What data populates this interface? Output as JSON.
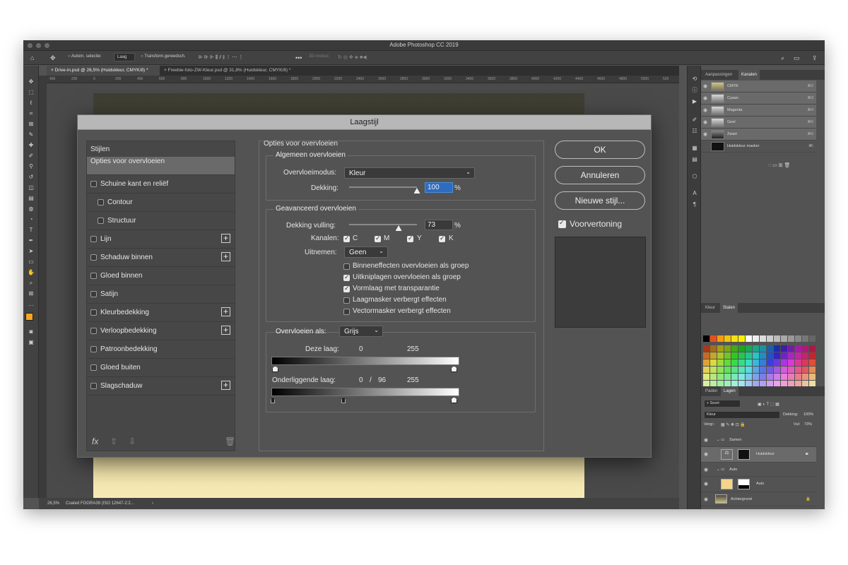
{
  "window": {
    "title": "Adobe Photoshop CC 2019"
  },
  "optionsbar": {
    "auto_select_label": "Autom. selectie:",
    "auto_select_value": "Laag",
    "transform_label": "Transform.gereedsch.",
    "mode_3d": "3D-modus:"
  },
  "doc_tabs": [
    {
      "label": "Drive-in.psd @ 26,5% (Huidskleur, CMYK/8) *"
    },
    {
      "label": "Freebie-foto-ZW-Kleur.psd @ 31,8% (Huidskleur, CMYK/8) *"
    }
  ],
  "ruler_ticks": [
    "400",
    "200",
    "0",
    "200",
    "400",
    "600",
    "800",
    "1000",
    "1200",
    "1400",
    "1600",
    "1800",
    "2000",
    "2200",
    "2400",
    "2600",
    "2800",
    "3000",
    "3200",
    "3400",
    "3600",
    "3800",
    "4000",
    "4200",
    "4400",
    "4600",
    "4800",
    "5000",
    "520"
  ],
  "status": {
    "zoom": "26,5%",
    "profile": "Coated FOGRA39 (ISO 12647-2:2..."
  },
  "panels": {
    "top_tabs": [
      "Aanpassingen",
      "Kanalen"
    ],
    "channels": [
      {
        "name": "CMYK",
        "shortcut": "⌘2"
      },
      {
        "name": "Cyaan",
        "shortcut": "⌘3"
      },
      {
        "name": "Magenta",
        "shortcut": "⌘4"
      },
      {
        "name": "Geel",
        "shortcut": "⌘5"
      },
      {
        "name": "Zwart",
        "shortcut": "⌘6"
      },
      {
        "name": "Huidskleur masker",
        "shortcut": "⌘\\"
      }
    ],
    "mid_tabs": [
      "Kleur",
      "Stalen"
    ],
    "layers_tabs": [
      "Paden",
      "Lagen"
    ],
    "layers_filter": "Soort",
    "blend": "Kleur",
    "opacity_label": "Dekking:",
    "opacity_value": "100%",
    "lock_label": "Vergr.:",
    "fill_label": "Vul:",
    "fill_value": "73%",
    "layers": [
      {
        "name": "Samen",
        "kind": "group"
      },
      {
        "name": "Huidskleur",
        "kind": "adjust"
      },
      {
        "name": "Auto",
        "kind": "group"
      },
      {
        "name": "Auto",
        "kind": "adjust"
      },
      {
        "name": "Achtergrond",
        "kind": "bg"
      }
    ]
  },
  "dialog": {
    "title": "Laagstijl",
    "styles_header": "Stijlen",
    "styles": [
      {
        "label": "Opties voor overvloeien",
        "selected": true,
        "checkbox": false,
        "plus": false,
        "indent": 0
      },
      {
        "label": "Schuine kant en reliëf",
        "checkbox": true,
        "plus": false,
        "indent": 0
      },
      {
        "label": "Contour",
        "checkbox": true,
        "plus": false,
        "indent": 1
      },
      {
        "label": "Structuur",
        "checkbox": true,
        "plus": false,
        "indent": 1
      },
      {
        "label": "Lijn",
        "checkbox": true,
        "plus": true,
        "indent": 0
      },
      {
        "label": "Schaduw binnen",
        "checkbox": true,
        "plus": true,
        "indent": 0
      },
      {
        "label": "Gloed binnen",
        "checkbox": true,
        "plus": false,
        "indent": 0
      },
      {
        "label": "Satijn",
        "checkbox": true,
        "plus": false,
        "indent": 0
      },
      {
        "label": "Kleurbedekking",
        "checkbox": true,
        "plus": true,
        "indent": 0
      },
      {
        "label": "Verloopbedekking",
        "checkbox": true,
        "plus": true,
        "indent": 0
      },
      {
        "label": "Patroonbedekking",
        "checkbox": true,
        "plus": false,
        "indent": 0
      },
      {
        "label": "Gloed buiten",
        "checkbox": true,
        "plus": false,
        "indent": 0
      },
      {
        "label": "Slagschaduw",
        "checkbox": true,
        "plus": true,
        "indent": 0
      }
    ],
    "fx_label": "fx",
    "section_title": "Opties voor overvloeien",
    "general": {
      "title": "Algemeen overvloeien",
      "blend_label": "Overvloeimodus:",
      "blend_value": "Kleur",
      "opacity_label": "Dekking:",
      "opacity_value": "100",
      "opacity_fraction": 1.0,
      "percent": "%"
    },
    "advanced": {
      "title": "Geavanceerd overvloeien",
      "fill_label": "Dekking vulling:",
      "fill_value": "73",
      "fill_fraction": 0.73,
      "percent": "%",
      "channels_label": "Kanalen:",
      "channels": [
        {
          "label": "C",
          "checked": true
        },
        {
          "label": "M",
          "checked": true
        },
        {
          "label": "Y",
          "checked": true
        },
        {
          "label": "K",
          "checked": true
        }
      ],
      "knockout_label": "Uitnemen:",
      "knockout_value": "Geen",
      "options": [
        {
          "label": "Binneneffecten overvloeien als groep",
          "checked": false
        },
        {
          "label": "Uitkniplagen overvloeien als groep",
          "checked": true
        },
        {
          "label": "Vormlaag met transparantie",
          "checked": true
        },
        {
          "label": "Laagmasker verbergt effecten",
          "checked": false
        },
        {
          "label": "Vectormasker verbergt effecten",
          "checked": false
        }
      ]
    },
    "blendif": {
      "label": "Overvloeien als:",
      "value": "Grijs",
      "this_layer_label": "Deze laag:",
      "this_low": "0",
      "this_high": "255",
      "underlying_label": "Onderliggende laag:",
      "under_low": "0",
      "under_sep": "/",
      "under_split": "96",
      "under_high": "255"
    },
    "buttons": {
      "ok": "OK",
      "cancel": "Annuleren",
      "new_style": "Nieuwe stijl..."
    },
    "preview_label": "Voorvertoning",
    "preview_checked": true
  },
  "colors": {
    "accent": "#4a90d9",
    "fg_swatch": "#f5a623"
  }
}
